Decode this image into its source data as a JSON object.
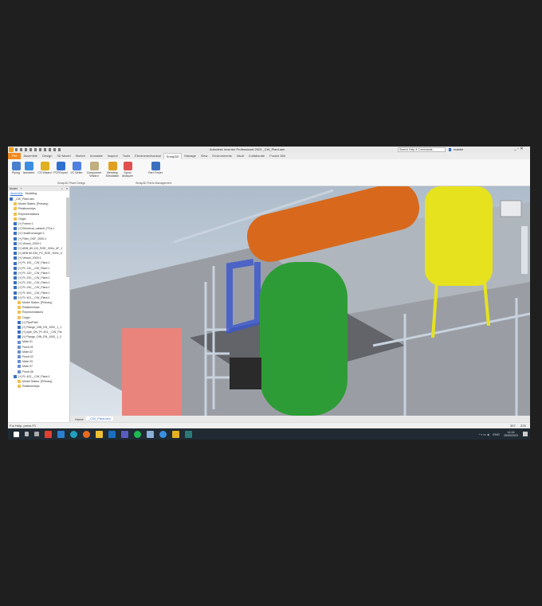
{
  "window": {
    "title": "Autodesk Inventor Professional 2023   _CW_Plant.iam",
    "search_placeholder": "Search Help & Commands...",
    "user": "mabbe"
  },
  "tabs": [
    "File",
    "Assemble",
    "Design",
    "3D Model",
    "Sketch",
    "Annotate",
    "Inspect",
    "Tools",
    "Electromechanical",
    "Smap3D",
    "Manage",
    "View",
    "Environments",
    "Vault",
    "Collaborate",
    "Fusion 360"
  ],
  "active_tab": "Smap3D",
  "ribbon": {
    "buttons": [
      "Piping",
      "Isometric",
      "CS Wizard",
      "PCFExport",
      "VC Writer",
      "Component Wizard",
      "Bending Simulation",
      "Spool Analyzer",
      "Part Finder"
    ],
    "groups": [
      "Smap3D Plant Design",
      "Smap3D Parts Management"
    ]
  },
  "browser": {
    "tabs": [
      "Model",
      "+"
    ],
    "subtabs": [
      "Assembly",
      "Modeling"
    ],
    "items": [
      "_CW_Plant.iam",
      "Model States: [Primary]",
      "Relationships",
      "Representations",
      "Origin",
      "[+] Frame:1",
      "[+] Electrical_cabinet_PCa:1",
      "[+] HeatExchanger:1",
      "[+] Filter_DSF_2000:1",
      "[+] Vessel_2000:1",
      "[+] ABB_80-110_RGE_30Hz_#F_1",
      "[+] ABB 80-030_P2_RGE_30Hz_#",
      "[+] Vessel_2000:1",
      "[+] PL 100__CW_Plant:1",
      "[+] PL 110__CW_Plant:1",
      "[+] PL 120__CW_Plant:1",
      "[+] PL 220__CW_Plant:1",
      "[+] PL 230__CW_Plant:1",
      "[+] PL 240__CW_Plant:1",
      "[+] PL 400__CW_Plant:1",
      "[+] PL 401__CW_Plant:1",
      "Model States: [Primary]",
      "Relationships",
      "Representations",
      "Origin",
      "[+] PipePath",
      "[+] Flange_DIN_EN_1092_1_1",
      "[+] pipe_DN_PL 401__CW_Pla",
      "[+] Flange_DIN_EN_1092_1_2",
      "Mate:31",
      "Flush:31",
      "Mate:32",
      "Flush:32",
      "Mate:33",
      "Mate:37",
      "Flush:35",
      "[+] PL 402__CW_Plant:1",
      "Model States: [Primary]",
      "Relationships"
    ]
  },
  "doc_tabs": [
    "Home",
    "_CW_Plant.iam"
  ],
  "status": {
    "help": "For Help, press F1",
    "count_a": "397",
    "count_b": "225"
  },
  "taskbar": {
    "time": "14:16",
    "date": "26/05/2023",
    "lang": "ENG"
  }
}
